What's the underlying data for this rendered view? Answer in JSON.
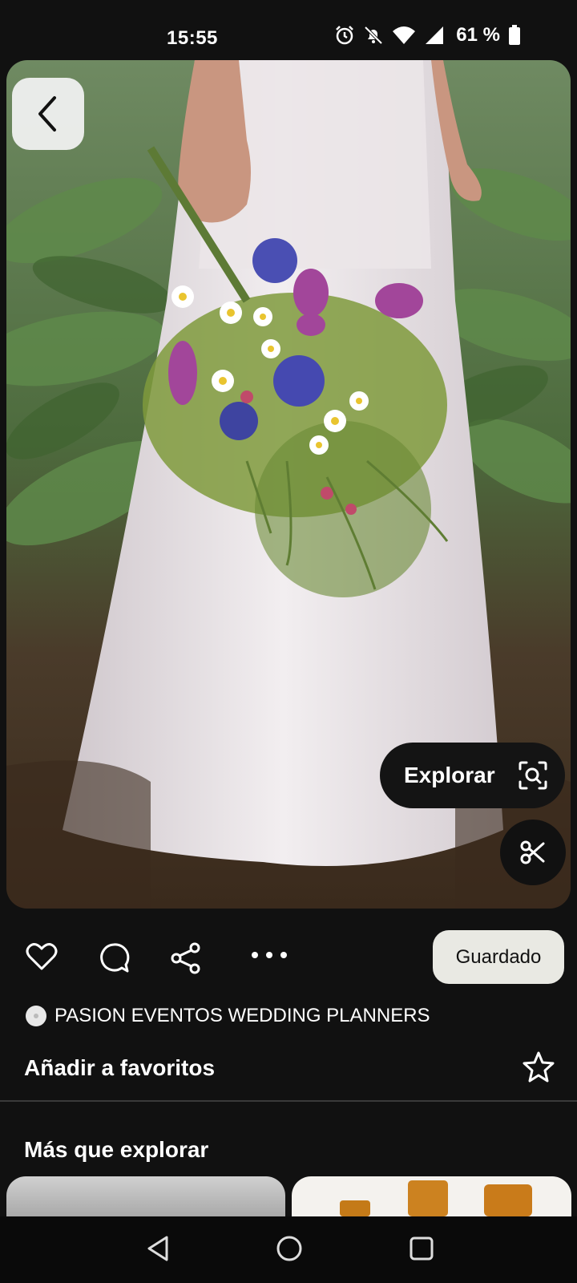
{
  "status_bar": {
    "time": "15:55",
    "battery": "61 %",
    "icons": [
      "alarm-icon",
      "notifications-off-icon",
      "wifi-icon",
      "signal-icon",
      "battery-icon"
    ]
  },
  "pin": {
    "explore_label": "Explorar",
    "saved_label": "Guardado",
    "creator_name": "PASION EVENTOS WEDDING PLANNERS",
    "favorites_label": "Añadir a favoritos",
    "more_to_explore": "Más que explorar"
  },
  "icons": {
    "back": "chevron-left-icon",
    "lens": "visual-search-icon",
    "scissors": "scissors-icon",
    "like": "heart-icon",
    "comment": "comment-icon",
    "share": "share-icon",
    "more": "more-icon",
    "star": "star-icon"
  },
  "colors": {
    "background": "#111111",
    "saved_button_bg": "#e9e9e3",
    "text": "#ffffff"
  },
  "navigation": {
    "buttons": [
      "back-nav-icon",
      "home-nav-icon",
      "recents-nav-icon"
    ]
  }
}
